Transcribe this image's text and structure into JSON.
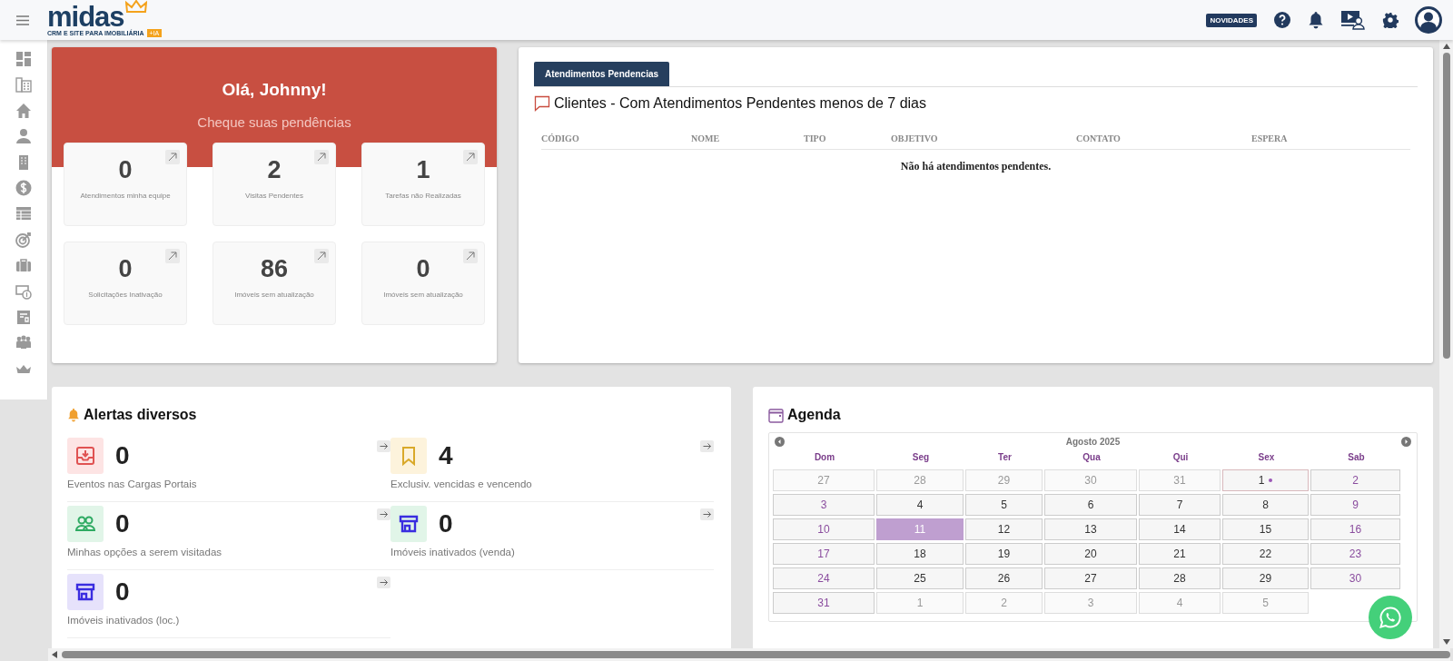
{
  "header": {
    "logo": "midas",
    "tagline": "CRM E SITE PARA IMOBILIÁRIA",
    "logo_badge": "+IA",
    "news_button": "NOVIDADES"
  },
  "welcome": {
    "greeting": "Olá, Johnny!",
    "subtitle": "Cheque suas pendências",
    "stats": [
      {
        "value": "0",
        "label": "Atendimentos minha equipe"
      },
      {
        "value": "2",
        "label": "Visitas Pendentes"
      },
      {
        "value": "1",
        "label": "Tarefas não Realizadas"
      },
      {
        "value": "0",
        "label": "Solicitações Inativação"
      },
      {
        "value": "86",
        "label": "Imóveis sem atualização"
      },
      {
        "value": "0",
        "label": "Imóveis sem atualização"
      }
    ]
  },
  "pending": {
    "tabs": [
      {
        "label": "Atendimentos Pendencias",
        "selected": true
      }
    ],
    "title": "Clientes - Com Atendimentos Pendentes menos de 7 dias",
    "columns": [
      "CÓDIGO",
      "NOME",
      "TIPO",
      "OBJETIVO",
      "CONTATO",
      "ESPERA"
    ],
    "empty_message": "Não há atendimentos pendentes."
  },
  "alerts": {
    "title": "Alertas diversos",
    "items": [
      {
        "kind": "inbox",
        "color": "#fde4e4",
        "value": "0",
        "label": "Eventos nas Cargas Portais"
      },
      {
        "kind": "bookmark",
        "color": "#fdf3dc",
        "value": "4",
        "label": "Exclusiv. vencidas e vencendo"
      },
      {
        "kind": "people",
        "color": "#e1f5e8",
        "value": "0",
        "label": "Minhas opções a serem visitadas"
      },
      {
        "kind": "store",
        "color": "#e1f5e8",
        "value": "0",
        "label": "Imóveis inativados (venda)"
      },
      {
        "kind": "store",
        "color": "#e6e2fb",
        "value": "0",
        "label": "Imóveis inativados (loc.)"
      }
    ]
  },
  "agenda": {
    "title": "Agenda",
    "month": "Agosto 2025",
    "weekdays": [
      "Dom",
      "Seg",
      "Ter",
      "Qua",
      "Qui",
      "Sex",
      "Sab"
    ],
    "weeks": [
      [
        {
          "day": "27",
          "kind": "muted",
          "selected": false,
          "marked": false
        },
        {
          "day": "28",
          "kind": "muted",
          "selected": false,
          "marked": false
        },
        {
          "day": "29",
          "kind": "muted",
          "selected": false,
          "marked": false
        },
        {
          "day": "30",
          "kind": "muted",
          "selected": false,
          "marked": false
        },
        {
          "day": "31",
          "kind": "muted",
          "selected": false,
          "marked": false
        },
        {
          "day": "1",
          "kind": "weekday",
          "selected": false,
          "marked": true
        },
        {
          "day": "2",
          "kind": "weekend",
          "selected": false,
          "marked": false
        }
      ],
      [
        {
          "day": "3",
          "kind": "weekend",
          "selected": false,
          "marked": false
        },
        {
          "day": "4",
          "kind": "weekday",
          "selected": false,
          "marked": false
        },
        {
          "day": "5",
          "kind": "weekday",
          "selected": false,
          "marked": false
        },
        {
          "day": "6",
          "kind": "weekday",
          "selected": false,
          "marked": false
        },
        {
          "day": "7",
          "kind": "weekday",
          "selected": false,
          "marked": false
        },
        {
          "day": "8",
          "kind": "weekday",
          "selected": false,
          "marked": false
        },
        {
          "day": "9",
          "kind": "weekend",
          "selected": false,
          "marked": false
        }
      ],
      [
        {
          "day": "10",
          "kind": "weekend",
          "selected": false,
          "marked": false
        },
        {
          "day": "11",
          "kind": "weekday",
          "selected": true,
          "marked": false
        },
        {
          "day": "12",
          "kind": "weekday",
          "selected": false,
          "marked": false
        },
        {
          "day": "13",
          "kind": "weekday",
          "selected": false,
          "marked": false
        },
        {
          "day": "14",
          "kind": "weekday",
          "selected": false,
          "marked": false
        },
        {
          "day": "15",
          "kind": "weekday",
          "selected": false,
          "marked": false
        },
        {
          "day": "16",
          "kind": "weekend",
          "selected": false,
          "marked": false
        }
      ],
      [
        {
          "day": "17",
          "kind": "weekend",
          "selected": false,
          "marked": false
        },
        {
          "day": "18",
          "kind": "weekday",
          "selected": false,
          "marked": false
        },
        {
          "day": "19",
          "kind": "weekday",
          "selected": false,
          "marked": false
        },
        {
          "day": "20",
          "kind": "weekday",
          "selected": false,
          "marked": false
        },
        {
          "day": "21",
          "kind": "weekday",
          "selected": false,
          "marked": false
        },
        {
          "day": "22",
          "kind": "weekday",
          "selected": false,
          "marked": false
        },
        {
          "day": "23",
          "kind": "weekend",
          "selected": false,
          "marked": false
        }
      ],
      [
        {
          "day": "24",
          "kind": "weekend",
          "selected": false,
          "marked": false
        },
        {
          "day": "25",
          "kind": "weekday",
          "selected": false,
          "marked": false
        },
        {
          "day": "26",
          "kind": "weekday",
          "selected": false,
          "marked": false
        },
        {
          "day": "27",
          "kind": "weekday",
          "selected": false,
          "marked": false
        },
        {
          "day": "28",
          "kind": "weekday",
          "selected": false,
          "marked": false
        },
        {
          "day": "29",
          "kind": "weekday",
          "selected": false,
          "marked": false
        },
        {
          "day": "30",
          "kind": "weekend",
          "selected": false,
          "marked": false
        }
      ],
      [
        {
          "day": "31",
          "kind": "weekend",
          "selected": false,
          "marked": false
        },
        {
          "day": "1",
          "kind": "muted",
          "selected": false,
          "marked": false
        },
        {
          "day": "2",
          "kind": "muted",
          "selected": false,
          "marked": false
        },
        {
          "day": "3",
          "kind": "muted",
          "selected": false,
          "marked": false
        },
        {
          "day": "4",
          "kind": "muted",
          "selected": false,
          "marked": false
        },
        {
          "day": "5",
          "kind": "muted",
          "selected": false,
          "marked": false
        }
      ]
    ]
  }
}
